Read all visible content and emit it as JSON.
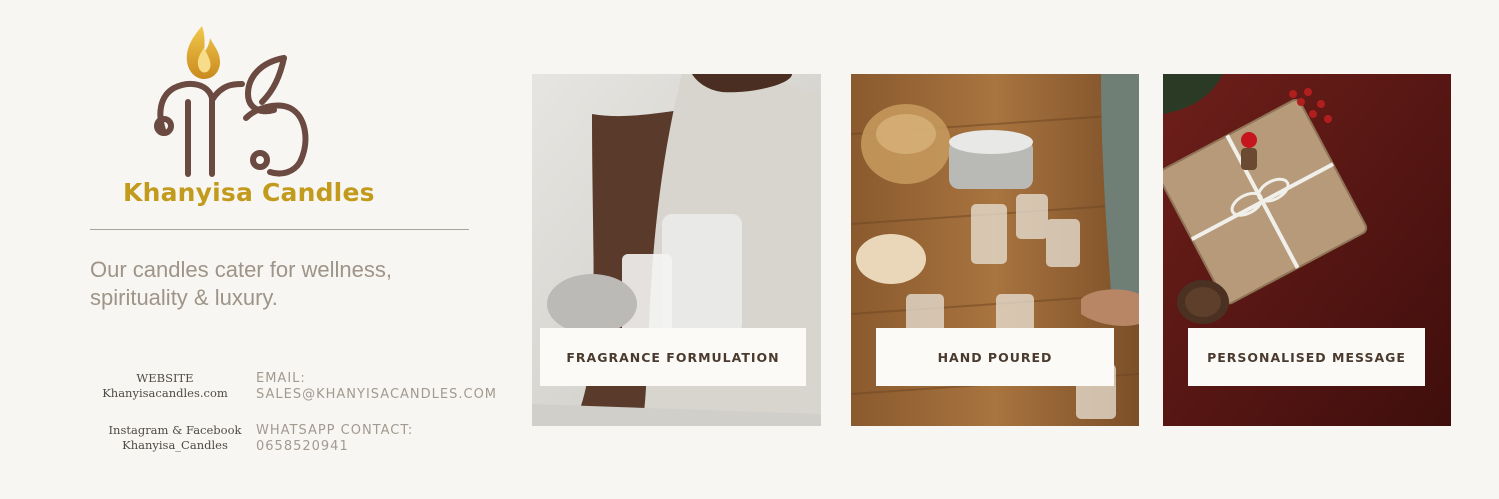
{
  "brand": {
    "name": "Khanyisa Candles"
  },
  "tagline": "Our candles cater for wellness, spirituality & luxury.",
  "contact": {
    "website_label": "WEBSITE",
    "website_value": "Khanyisacandles.com",
    "social_label": "Instagram & Facebook",
    "social_value": "Khanyisa_Candles",
    "email_label": "EMAIL:",
    "email_value": "SALES@KHANYISACANDLES.COM",
    "whatsapp_label": "WHATSAPP CONTACT:",
    "whatsapp_value": "0658520941"
  },
  "cards": [
    {
      "label": "FRAGRANCE FORMULATION"
    },
    {
      "label": "HAND POURED"
    },
    {
      "label": "PERSONALISED MESSAGE"
    }
  ],
  "colors": {
    "background": "#f8f6f2",
    "brand_gold": "#c29a1c",
    "logo_brown": "#6b4a42",
    "text_muted": "#9e9488"
  }
}
